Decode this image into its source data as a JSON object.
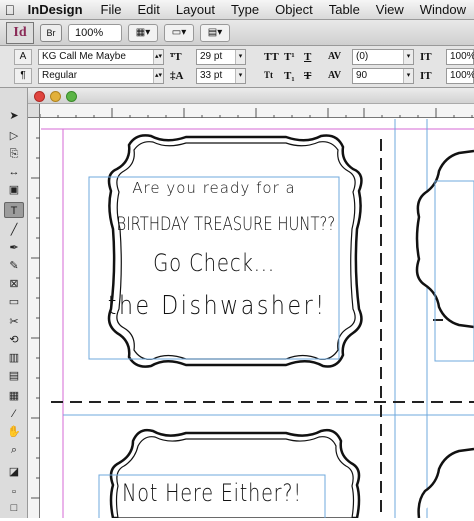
{
  "menubar": {
    "app_name": "InDesign",
    "items": [
      "File",
      "Edit",
      "Layout",
      "Type",
      "Object",
      "Table",
      "View",
      "Window"
    ]
  },
  "appbar": {
    "logo": "Id",
    "bridge_label": "Br",
    "zoom": "100%"
  },
  "control_panel": {
    "character_mode_label": "A",
    "paragraph_mode_label": "¶",
    "font_family": "KG Call Me Maybe",
    "font_style": "Regular",
    "font_size": "29 pt",
    "leading": "33 pt",
    "kerning": "(0)",
    "tracking": "90",
    "vertical_scale": "100%",
    "horizontal_scale": "100%",
    "allcaps_label": "TT",
    "superscript_label": "T¹",
    "underline_label": "T",
    "smallcaps_label": "Tt",
    "subscript_label": "T₁",
    "strike_label": "T"
  },
  "colors": {
    "guide_magenta": "#d66ad6",
    "guide_blue": "#6fa8dc",
    "accent_text": "#111111"
  },
  "document": {
    "card1": {
      "line1": "Are you ready for a",
      "line2": "BIRTHDAY TREASURE HUNT??",
      "line3": "Go Check...",
      "line4": "the Dishwasher!"
    },
    "card2": {
      "line1": "Not Here Either?!"
    }
  }
}
